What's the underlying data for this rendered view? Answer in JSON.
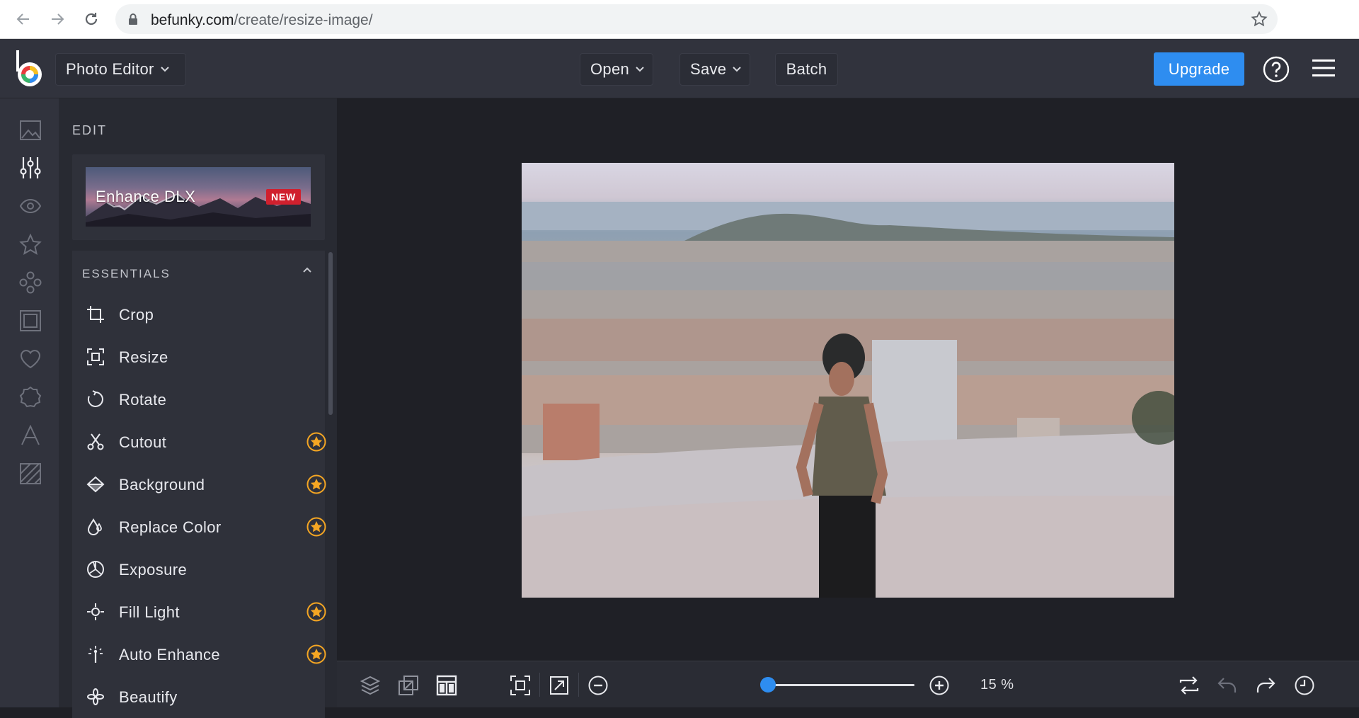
{
  "browser": {
    "url_host": "befunky.com",
    "url_path": "/create/resize-image/"
  },
  "topbar": {
    "app_mode": "Photo Editor",
    "open_label": "Open",
    "save_label": "Save",
    "batch_label": "Batch",
    "upgrade_label": "Upgrade"
  },
  "rail": {
    "icons": [
      "image-icon",
      "sliders-icon",
      "eye-icon",
      "star-icon",
      "effects-icon",
      "frame-icon",
      "heart-icon",
      "badge-icon",
      "text-icon",
      "texture-icon"
    ]
  },
  "panel": {
    "title": "EDIT",
    "enhance": {
      "label": "Enhance DLX",
      "badge": "NEW"
    },
    "essentials": {
      "heading": "ESSENTIALS",
      "tools": [
        {
          "label": "Crop",
          "icon": "crop-icon",
          "premium": false
        },
        {
          "label": "Resize",
          "icon": "resize-icon",
          "premium": false
        },
        {
          "label": "Rotate",
          "icon": "rotate-icon",
          "premium": false
        },
        {
          "label": "Cutout",
          "icon": "scissors-icon",
          "premium": true
        },
        {
          "label": "Background",
          "icon": "eraser-icon",
          "premium": true
        },
        {
          "label": "Replace Color",
          "icon": "droplet-icon",
          "premium": true
        },
        {
          "label": "Exposure",
          "icon": "aperture-icon",
          "premium": false
        },
        {
          "label": "Fill Light",
          "icon": "sun-icon",
          "premium": true
        },
        {
          "label": "Auto Enhance",
          "icon": "magic-wand-icon",
          "premium": true
        },
        {
          "label": "Beautify",
          "icon": "sparkle-icon",
          "premium": false
        }
      ]
    }
  },
  "bottombar": {
    "zoom_label": "15 %",
    "zoom_value": 15
  },
  "colors": {
    "accent": "#2e8df0",
    "premium": "#f5a623",
    "new_badge": "#d0202e"
  }
}
